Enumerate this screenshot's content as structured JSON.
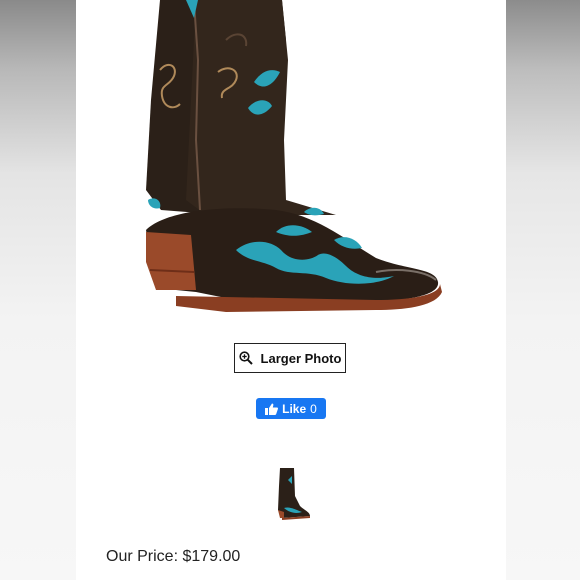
{
  "product": {
    "larger_photo_label": "Larger Photo",
    "like_label": "Like",
    "like_count": "0",
    "price_label": "Our Price:",
    "price_value": "$179.00"
  },
  "icons": {
    "zoom": "magnifier-plus-icon",
    "like": "thumbs-up-icon"
  },
  "colors": {
    "facebook_blue": "#1877f2",
    "boot_leather": "#2b1f18",
    "boot_inlay": "#2aa3b8",
    "boot_sole": "#9a4a2a"
  }
}
